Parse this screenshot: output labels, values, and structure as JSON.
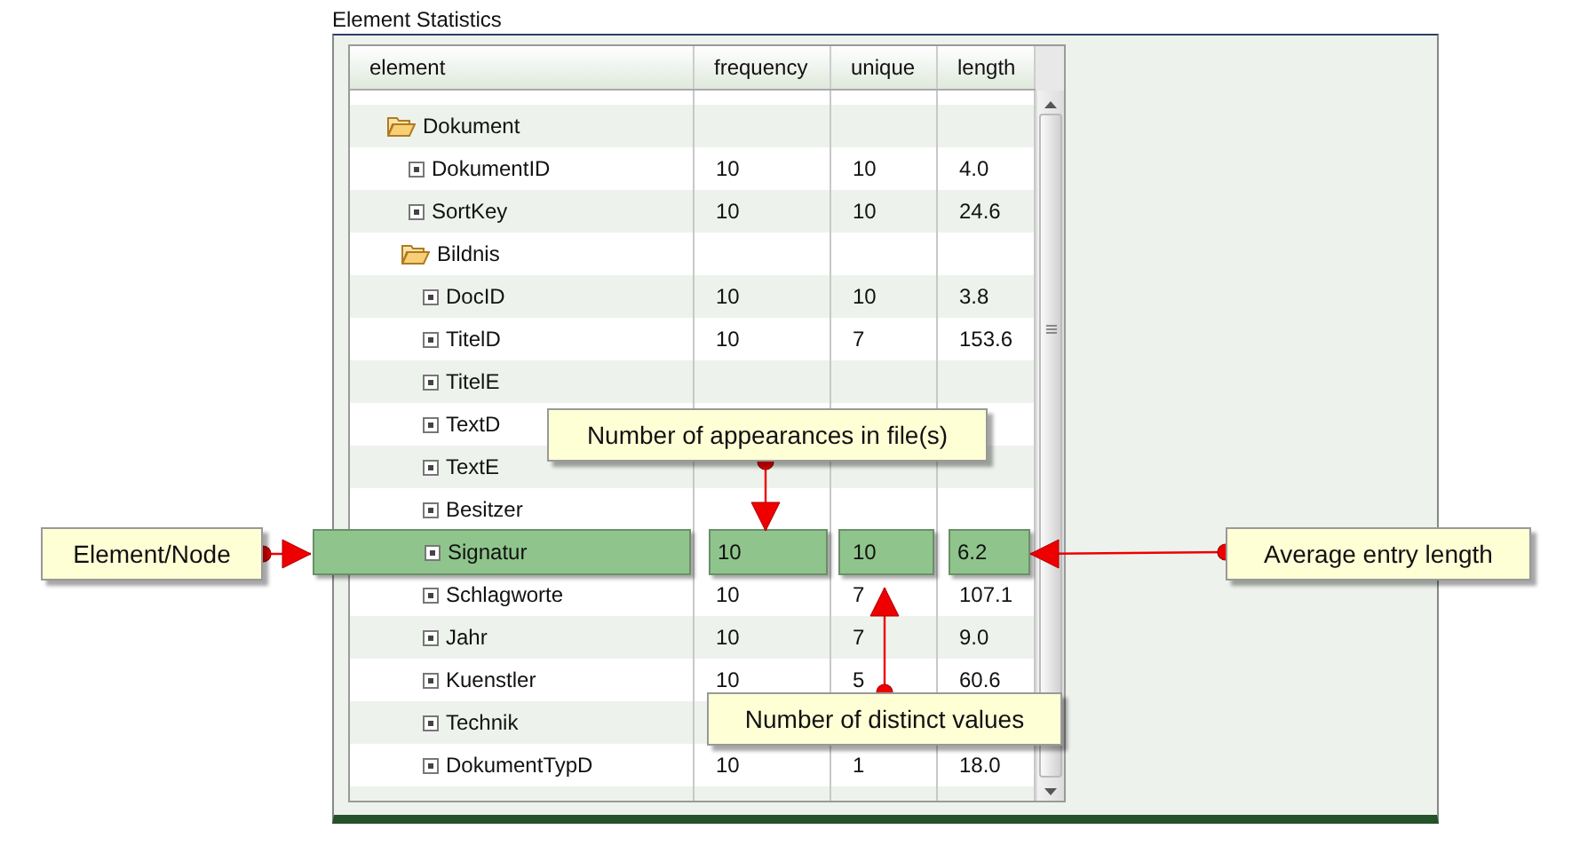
{
  "panel": {
    "title": "Element Statistics"
  },
  "table": {
    "columns": [
      "element",
      "frequency",
      "unique",
      "length"
    ],
    "rows": [
      {
        "name": "Dokument",
        "kind": "folder",
        "selected": false,
        "children": [
          {
            "name": "DokumentID",
            "kind": "leaf",
            "selected": false,
            "values": [
              "10",
              "10",
              "4.0"
            ]
          },
          {
            "name": "SortKey",
            "kind": "leaf",
            "selected": false,
            "values": [
              "10",
              "10",
              "24.6"
            ]
          },
          {
            "name": "Bildnis",
            "kind": "folder",
            "selected": false,
            "children": [
              {
                "name": "DocID",
                "kind": "leaf",
                "selected": false,
                "values": [
                  "10",
                  "10",
                  "3.8"
                ]
              },
              {
                "name": "TitelD",
                "kind": "leaf",
                "selected": false,
                "values": [
                  "10",
                  "7",
                  "153.6"
                ]
              },
              {
                "name": "TitelE",
                "kind": "leaf",
                "selected": false
              },
              {
                "name": "TextD",
                "kind": "leaf",
                "selected": false
              },
              {
                "name": "TextE",
                "kind": "leaf",
                "selected": false
              },
              {
                "name": "Besitzer",
                "kind": "leaf",
                "selected": false
              },
              {
                "name": "Signatur",
                "kind": "leaf",
                "selected": true,
                "values": [
                  "10",
                  "10",
                  "6.2"
                ]
              },
              {
                "name": "Schlagworte",
                "kind": "leaf",
                "selected": false,
                "values": [
                  "10",
                  "7",
                  "107.1"
                ]
              },
              {
                "name": "Jahr",
                "kind": "leaf",
                "selected": false,
                "values": [
                  "10",
                  "7",
                  "9.0"
                ]
              },
              {
                "name": "Kuenstler",
                "kind": "leaf",
                "selected": false,
                "values": [
                  "10",
                  "5",
                  "60.6"
                ]
              },
              {
                "name": "Technik",
                "kind": "leaf",
                "selected": false
              },
              {
                "name": "DokumentTypD",
                "kind": "leaf",
                "selected": false,
                "values": [
                  "10",
                  "1",
                  "18.0"
                ]
              }
            ]
          }
        ]
      }
    ]
  },
  "callouts": [
    {
      "text": "Element/Node"
    },
    {
      "text": "Number of appearances in file(s)"
    },
    {
      "text": "Number of distinct values"
    },
    {
      "text": "Average entry length"
    }
  ]
}
